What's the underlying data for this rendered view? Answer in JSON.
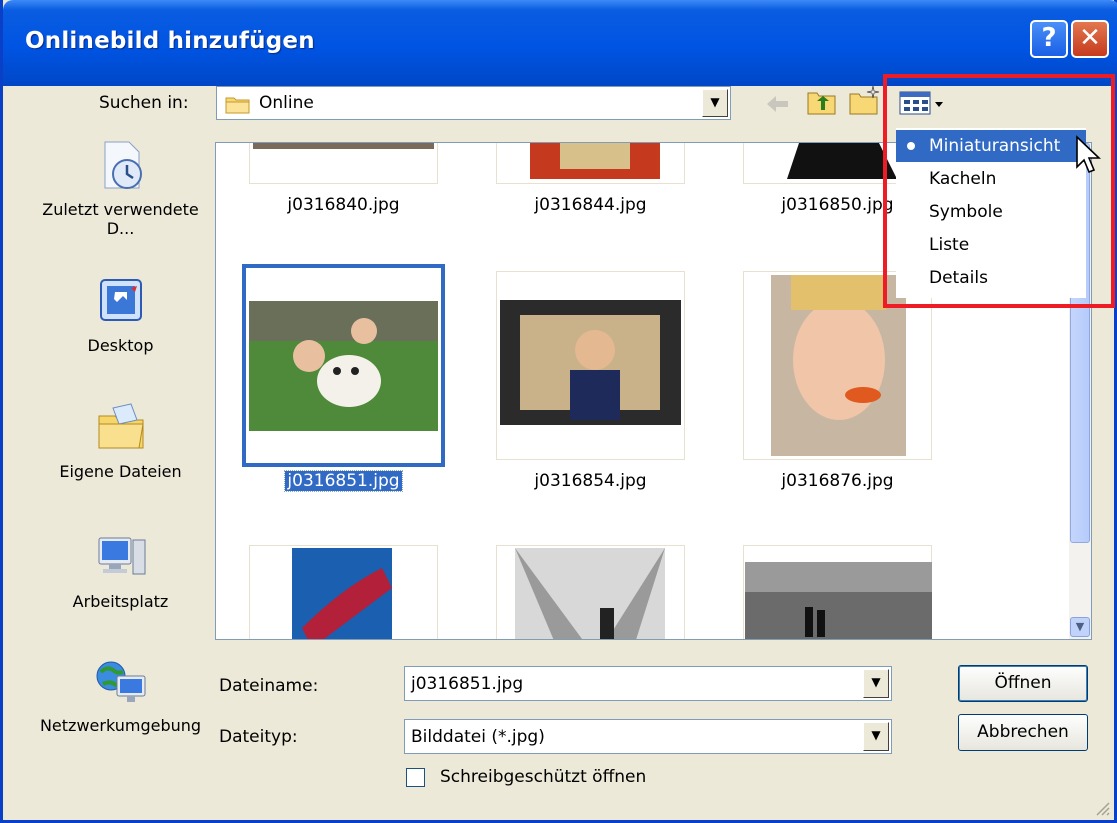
{
  "window": {
    "title": "Onlinebild hinzufügen",
    "help_glyph": "?",
    "close_glyph": "✕"
  },
  "look_in": {
    "label": "Suchen in:",
    "value": "Online"
  },
  "places": [
    {
      "label": "Zuletzt verwendete D...",
      "icon": "recent-documents-icon"
    },
    {
      "label": "Desktop",
      "icon": "desktop-icon"
    },
    {
      "label": "Eigene Dateien",
      "icon": "my-documents-icon"
    },
    {
      "label": "Arbeitsplatz",
      "icon": "my-computer-icon"
    },
    {
      "label": "Netzwerkumgebung",
      "icon": "network-places-icon"
    }
  ],
  "files": [
    {
      "name": "j0316840.jpg",
      "selected": false
    },
    {
      "name": "j0316844.jpg",
      "selected": false
    },
    {
      "name": "j0316850.jpg",
      "selected": false
    },
    {
      "name": "j0316851.jpg",
      "selected": true
    },
    {
      "name": "j0316854.jpg",
      "selected": false
    },
    {
      "name": "j0316876.jpg",
      "selected": false
    },
    {
      "name": "",
      "selected": false
    },
    {
      "name": "",
      "selected": false
    },
    {
      "name": "",
      "selected": false
    }
  ],
  "view_menu": {
    "items": [
      "Miniaturansicht",
      "Kacheln",
      "Symbole",
      "Liste",
      "Details"
    ],
    "checked": "Miniaturansicht"
  },
  "filename": {
    "label": "Dateiname:",
    "value": "j0316851.jpg"
  },
  "filetype": {
    "label": "Dateityp:",
    "value": "Bilddatei (*.jpg)"
  },
  "readonly_checkbox": {
    "label": "Schreibgeschützt öffnen",
    "checked": false
  },
  "buttons": {
    "open": "Öffnen",
    "cancel": "Abbrechen"
  },
  "colors": {
    "title_bar": "#0054e3",
    "selection": "#316ac5",
    "highlight_box": "#ee1c24",
    "dialog_bg": "#ece9d8"
  }
}
